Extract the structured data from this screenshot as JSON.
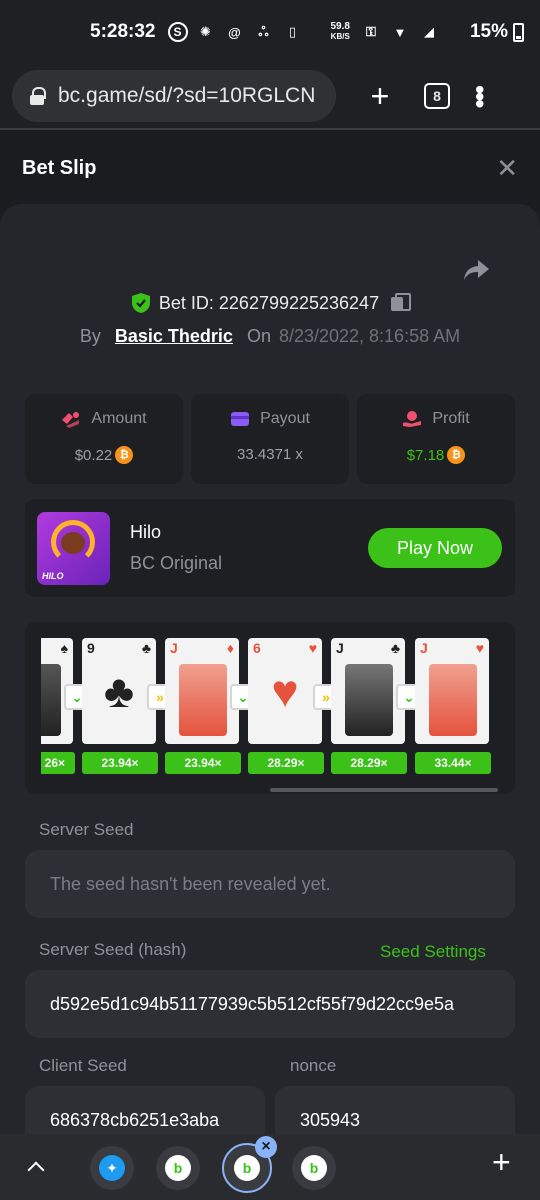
{
  "status_bar": {
    "time": "5:28:32",
    "net_speed": "59.8",
    "net_unit": "KB/S",
    "battery": "15%"
  },
  "browser": {
    "url": "bc.game/sd/?sd=10RGLCN",
    "tab_count": "8"
  },
  "bet_slip": {
    "title": "Bet Slip",
    "bet_id_label": "Bet ID: 2262799225236247",
    "by_label": "By",
    "user": "Basic Thedric",
    "on_label": "On",
    "date": "8/23/2022, 8:16:58 AM"
  },
  "stats": {
    "amount_label": "Amount",
    "amount_value": "$0.22",
    "payout_label": "Payout",
    "payout_value": "33.4371 x",
    "profit_label": "Profit",
    "profit_value": "$7.18",
    "coin_symbol": "₿"
  },
  "game": {
    "name": "Hilo",
    "sub": "BC Original",
    "thumb_text": "HILO",
    "play_label": "Play Now"
  },
  "cards": [
    {
      "rank": "",
      "suit": "♠",
      "color": "black"
    },
    {
      "rank": "9",
      "suit": "♣",
      "color": "black"
    },
    {
      "rank": "J",
      "suit": "♦",
      "color": "red"
    },
    {
      "rank": "6",
      "suit": "♥",
      "color": "red"
    },
    {
      "rank": "J",
      "suit": "♣",
      "color": "black"
    },
    {
      "rank": "J",
      "suit": "♥",
      "color": "red"
    }
  ],
  "multipliers": [
    "26×",
    "23.94×",
    "23.94×",
    "28.29×",
    "28.29×",
    "33.44×"
  ],
  "arrows": [
    "»",
    "»"
  ],
  "seeds": {
    "server_seed_label": "Server Seed",
    "server_seed_value": "The seed hasn't been revealed yet.",
    "server_hash_label": "Server Seed (hash)",
    "seed_settings_label": "Seed Settings",
    "server_hash_value": "d592e5d1c94b51177939c5b512cf55f79d22cc9e5a",
    "client_seed_label": "Client Seed",
    "client_seed_value": "686378cb6251e3aba",
    "nonce_label": "nonce",
    "nonce_value": "305943"
  },
  "colors": {
    "accent_green": "#3bc117",
    "background": "#1b1c20",
    "panel": "#25262b"
  }
}
